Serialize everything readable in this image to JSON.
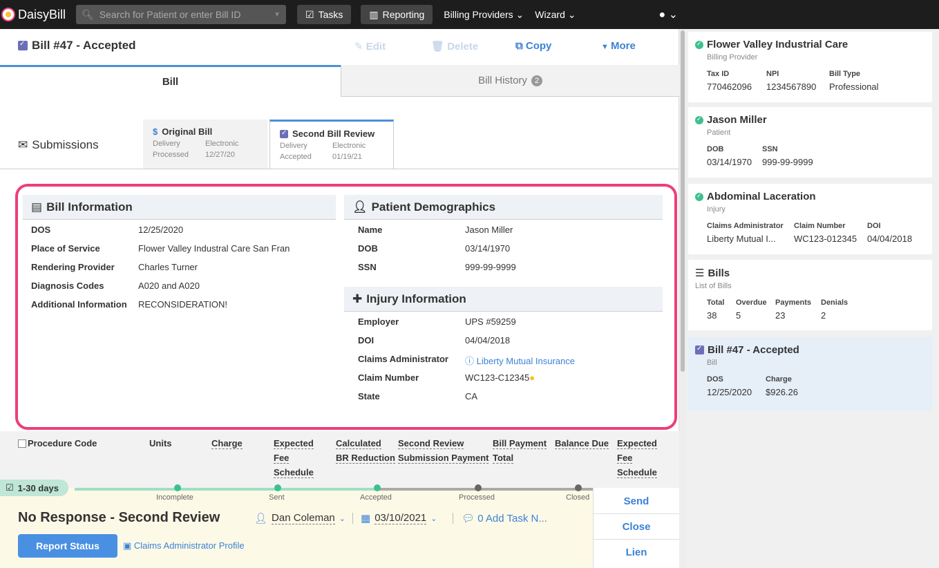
{
  "nav": {
    "logo_text": "DaisyBill",
    "search_placeholder": "Search for Patient or enter Bill ID",
    "tasks": "Tasks",
    "reporting": "Reporting",
    "billing_providers": "Billing Providers ⌄",
    "wizard": "Wizard ⌄",
    "user_menu": "⌄"
  },
  "header": {
    "bill_title": "Bill #47 - Accepted",
    "edit": "Edit",
    "delete": "Delete",
    "copy": "Copy",
    "more": "More"
  },
  "tabs": {
    "bill": "Bill",
    "history": "Bill History",
    "history_count": "2"
  },
  "submissions": {
    "label": "Submissions",
    "original": {
      "title": "Original Bill",
      "k1": "Delivery",
      "v1": "Electronic",
      "k2": "Processed",
      "v2": "12/27/20"
    },
    "second": {
      "title": "Second Bill Review",
      "k1": "Delivery",
      "v1": "Electronic",
      "k2": "Accepted",
      "v2": "01/19/21"
    }
  },
  "bill_info": {
    "title": "Bill Information",
    "rows": [
      {
        "label": "DOS",
        "value": "12/25/2020"
      },
      {
        "label": "Place of Service",
        "value": "Flower Valley Industral Care San Fran"
      },
      {
        "label": "Rendering Provider",
        "value": "Charles Turner"
      },
      {
        "label": "Diagnosis Codes",
        "value": "A020 and A020"
      },
      {
        "label": "Additional Information",
        "value": "RECONSIDERATION!"
      }
    ]
  },
  "patient_demo": {
    "title": "Patient Demographics",
    "rows": [
      {
        "label": "Name",
        "value": "Jason Miller"
      },
      {
        "label": "DOB",
        "value": "03/14/1970"
      },
      {
        "label": "SSN",
        "value": "999-99-9999"
      }
    ]
  },
  "injury_info": {
    "title": "Injury Information",
    "rows": [
      {
        "label": "Employer",
        "value": "UPS #59259"
      },
      {
        "label": "DOI",
        "value": "04/04/2018"
      },
      {
        "label": "Claims Administrator",
        "value": "Liberty Mutual Insurance"
      },
      {
        "label": "Claim Number",
        "value": "WC123-C12345"
      },
      {
        "label": "State",
        "value": "CA"
      }
    ]
  },
  "procedure_table": {
    "headers": {
      "code": "Procedure Code",
      "units": "Units",
      "charge": "Charge",
      "expected_fee_l1": "Expected",
      "expected_fee_l2": "Fee",
      "expected_fee_l3": "Schedule",
      "calc_l1": "Calculated",
      "calc_l2": "BR Reduction",
      "sbr_l1": "Second Review",
      "sbr_l2": "Submission Payment",
      "bp_l1": "Bill Payment",
      "bp_l2": "Total",
      "balance": "Balance Due",
      "efs2_l1": "Expected",
      "efs2_l2": "Fee",
      "efs2_l3": "Schedule",
      "efs2_l4": "%"
    }
  },
  "status": {
    "days": "1-30 days",
    "stages": [
      "Incomplete",
      "Sent",
      "Accepted",
      "Processed",
      "Closed"
    ],
    "title": "No Response - Second Review",
    "assignee": "Dan Coleman",
    "date": "03/10/2021",
    "add_task": "0 Add Task N...",
    "report_button": "Report Status",
    "ca_profile": "Claims Administrator Profile",
    "send": "Send",
    "close": "Close",
    "lien": "Lien"
  },
  "sidebar": {
    "provider": {
      "title": "Flower Valley Industrial Care",
      "subtitle": "Billing Provider",
      "cols": [
        {
          "k": "Tax ID",
          "v": "770462096"
        },
        {
          "k": "NPI",
          "v": "1234567890"
        },
        {
          "k": "Bill Type",
          "v": "Professional"
        }
      ]
    },
    "patient": {
      "title": "Jason Miller",
      "subtitle": "Patient",
      "cols": [
        {
          "k": "DOB",
          "v": "03/14/1970"
        },
        {
          "k": "SSN",
          "v": "999-99-9999"
        }
      ]
    },
    "injury": {
      "title": "Abdominal Laceration",
      "subtitle": "Injury",
      "cols": [
        {
          "k": "Claims Administrator",
          "v": "Liberty Mutual I..."
        },
        {
          "k": "Claim Number",
          "v": "WC123-012345"
        },
        {
          "k": "DOI",
          "v": "04/04/2018"
        }
      ]
    },
    "bills": {
      "title": "Bills",
      "subtitle": "List of Bills",
      "cols": [
        {
          "k": "Total",
          "v": "38"
        },
        {
          "k": "Overdue",
          "v": "5"
        },
        {
          "k": "Payments",
          "v": "23"
        },
        {
          "k": "Denials",
          "v": "2"
        }
      ]
    },
    "bill": {
      "title": "Bill #47 - Accepted",
      "subtitle": "Bill",
      "cols": [
        {
          "k": "DOS",
          "v": "12/25/2020"
        },
        {
          "k": "Charge",
          "v": "$926.26"
        }
      ]
    }
  },
  "colors": {
    "accent": "#4a90e2",
    "highlight": "#ec3f7a",
    "success": "#3ec08e",
    "purple_check": "#6b6fb7"
  }
}
